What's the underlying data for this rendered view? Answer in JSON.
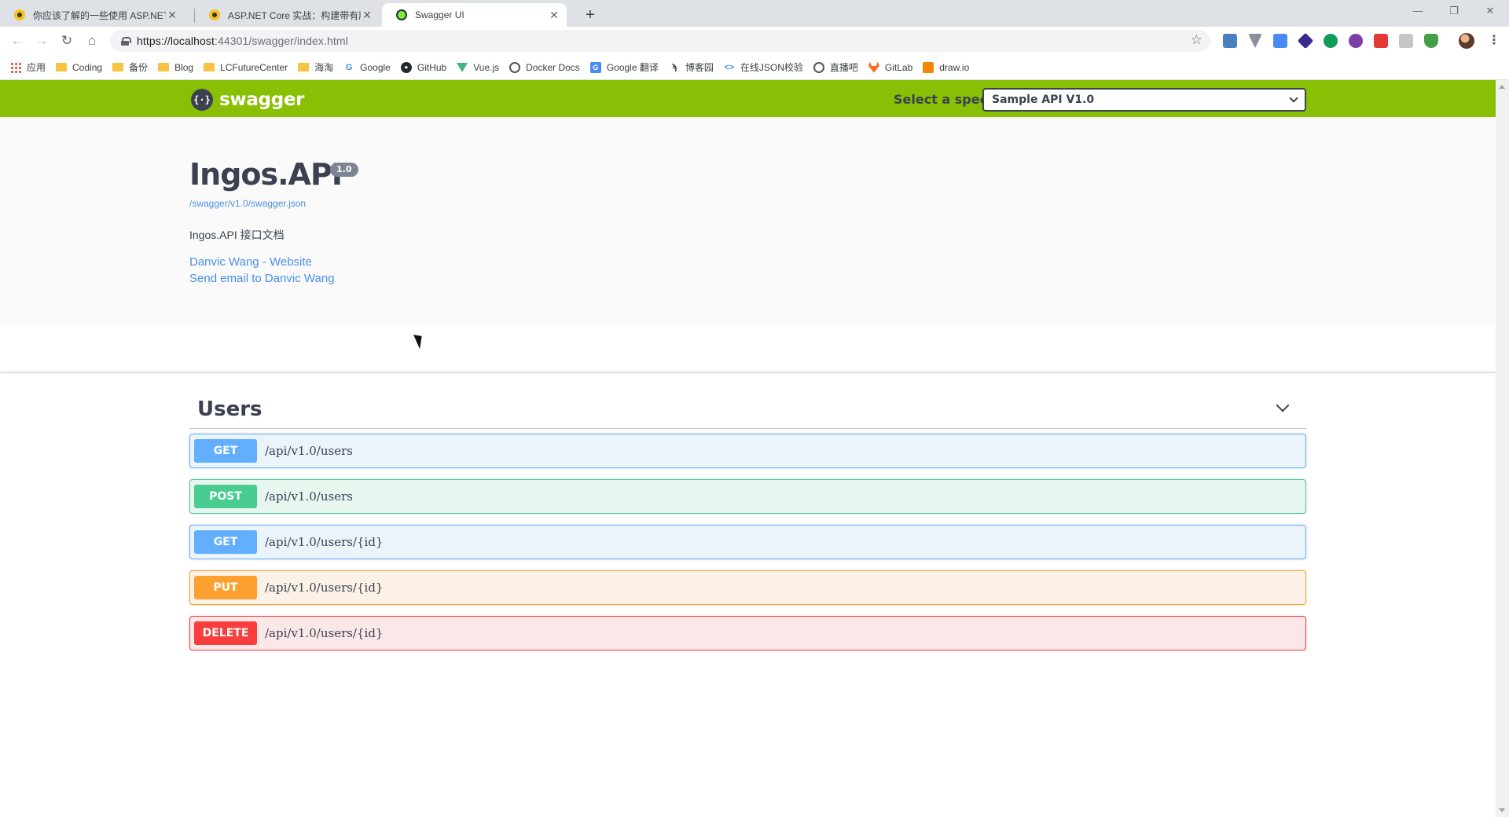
{
  "browser": {
    "tabs": [
      {
        "title": "你应该了解的一些使用 ASP.NET",
        "icon": "cnblogs-favicon-icon",
        "active": false
      },
      {
        "title": "ASP.NET Core 实战：构建带有版",
        "icon": "cnblogs-favicon-icon",
        "active": false
      },
      {
        "title": "Swagger UI",
        "icon": "swagger-favicon-icon",
        "active": true
      }
    ],
    "url_host": "https://localhost",
    "url_rest": ":44301/swagger/index.html",
    "bookmarks": [
      {
        "label": "应用",
        "icon": "apps-grid-icon"
      },
      {
        "label": "Coding",
        "icon": "folder-icon"
      },
      {
        "label": "备份",
        "icon": "folder-icon"
      },
      {
        "label": "Blog",
        "icon": "folder-icon"
      },
      {
        "label": "LCFutureCenter",
        "icon": "folder-icon"
      },
      {
        "label": "海淘",
        "icon": "folder-icon"
      },
      {
        "label": "Google",
        "icon": "google-icon"
      },
      {
        "label": "GitHub",
        "icon": "github-icon"
      },
      {
        "label": "Vue.js",
        "icon": "vue-icon"
      },
      {
        "label": "Docker Docs",
        "icon": "globe-icon"
      },
      {
        "label": "Google 翻译",
        "icon": "google-translate-icon"
      },
      {
        "label": "博客园",
        "icon": "cnblogs-icon"
      },
      {
        "label": "在线JSON校验",
        "icon": "code-icon"
      },
      {
        "label": "直播吧",
        "icon": "globe-icon"
      },
      {
        "label": "GitLab",
        "icon": "gitlab-icon"
      },
      {
        "label": "draw.io",
        "icon": "drawio-icon"
      }
    ]
  },
  "swagger": {
    "brand": "swagger",
    "select_label": "Select a spec",
    "selected_spec": "Sample API V1.0",
    "api_title": "Ingos.API",
    "version": "1.0",
    "spec_url": "/swagger/v1.0/swagger.json",
    "description": "Ingos.API 接口文档",
    "contact_website": "Danvic Wang - Website",
    "contact_email": "Send email to Danvic Wang",
    "tag": "Users",
    "operations": [
      {
        "method": "GET",
        "path": "/api/v1.0/users",
        "kind": "get"
      },
      {
        "method": "POST",
        "path": "/api/v1.0/users",
        "kind": "post"
      },
      {
        "method": "GET",
        "path": "/api/v1.0/users/{id}",
        "kind": "get"
      },
      {
        "method": "PUT",
        "path": "/api/v1.0/users/{id}",
        "kind": "put"
      },
      {
        "method": "DELETE",
        "path": "/api/v1.0/users/{id}",
        "kind": "delete"
      }
    ]
  },
  "colors": {
    "topbar": "#89bf04",
    "get": "#61affe",
    "post": "#49cc90",
    "put": "#fca130",
    "delete": "#f93e3e",
    "link": "#4990e2"
  }
}
